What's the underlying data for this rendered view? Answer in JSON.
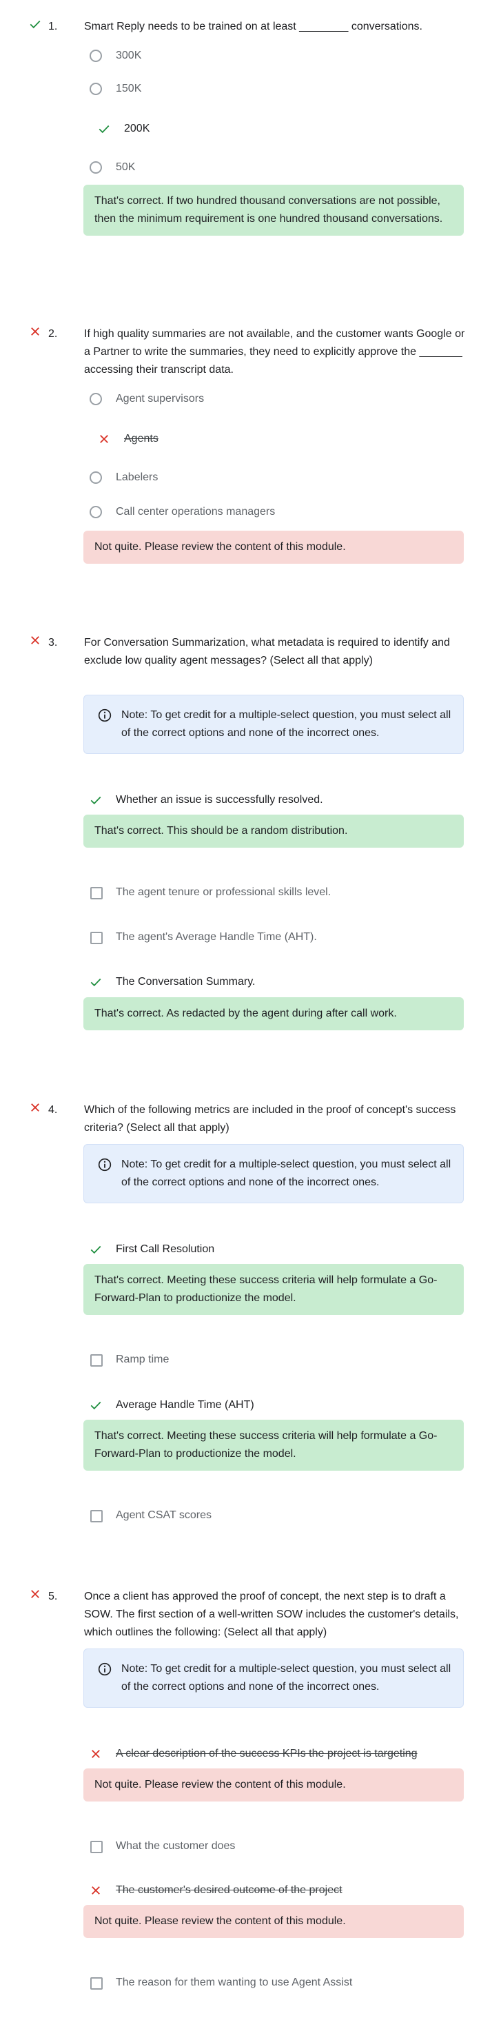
{
  "note_text": "Note: To get credit for a multiple-select question, you must select all of the correct options and none of the incorrect ones.",
  "colors": {
    "correct": "#1e8e3e",
    "incorrect": "#d93025",
    "success_bg": "#c8ecd0",
    "error_bg": "#f8d8d6",
    "note_bg": "#e6effc"
  },
  "questions": [
    {
      "number": "1.",
      "status": "correct",
      "text": "Smart Reply needs to be trained on at least ________ conversations.",
      "options": [
        {
          "label": "300K",
          "state": "unselected"
        },
        {
          "label": "150K",
          "state": "unselected"
        },
        {
          "label": "200K",
          "state": "correct"
        },
        {
          "label": "50K",
          "state": "unselected"
        }
      ],
      "feedback": "That's correct. If two hundred thousand conversations are not possible, then the minimum requirement is one hundred thousand conversations."
    },
    {
      "number": "2.",
      "status": "incorrect",
      "text": "If high quality summaries are not available, and the customer wants Google or a Partner to write the summaries, they need to explicitly approve the _______ accessing their transcript data.",
      "options": [
        {
          "label": "Agent supervisors",
          "state": "unselected"
        },
        {
          "label": "Agents",
          "state": "incorrect"
        },
        {
          "label": "Labelers",
          "state": "unselected"
        },
        {
          "label": "Call center operations managers",
          "state": "unselected"
        }
      ],
      "feedback": "Not quite. Please review the content of this module."
    },
    {
      "number": "3.",
      "status": "incorrect",
      "text": "For Conversation Summarization, what metadata is required to identify and exclude low quality agent messages? (Select all that apply)",
      "options": [
        {
          "label": "Whether an issue is successfully resolved.",
          "state": "correct",
          "feedback": "That's correct. This should be a random distribution."
        },
        {
          "label": "The agent tenure or professional skills level.",
          "state": "unselected"
        },
        {
          "label": "The agent's Average Handle Time (AHT).",
          "state": "unselected"
        },
        {
          "label": "The Conversation Summary.",
          "state": "correct",
          "feedback": "That's correct. As redacted by the agent during after call work."
        }
      ]
    },
    {
      "number": "4.",
      "status": "incorrect",
      "text": "Which of the following metrics are included in the proof of concept's success criteria? (Select all that apply)",
      "options": [
        {
          "label": "First Call Resolution",
          "state": "correct",
          "feedback": "That's correct. Meeting these success criteria will help formulate a Go-Forward-Plan to productionize the model."
        },
        {
          "label": "Ramp time",
          "state": "unselected"
        },
        {
          "label": "Average Handle Time (AHT)",
          "state": "correct",
          "feedback": "That's correct. Meeting these success criteria will help formulate a Go-Forward-Plan to productionize the model."
        },
        {
          "label": "Agent CSAT scores",
          "state": "unselected"
        }
      ]
    },
    {
      "number": "5.",
      "status": "incorrect",
      "text": "Once a client has approved the proof of concept, the next step is to draft a SOW. The first section of a well-written SOW includes the customer's details, which outlines the following: (Select all that apply)",
      "options": [
        {
          "label": "A clear description of the success KPIs the project is targeting",
          "state": "incorrect",
          "feedback": "Not quite. Please review the content of this module."
        },
        {
          "label": "What the customer does",
          "state": "unselected"
        },
        {
          "label": "The customer's desired outcome of the project",
          "state": "incorrect",
          "feedback": "Not quite. Please review the content of this module."
        },
        {
          "label": "The reason for them wanting to use Agent Assist",
          "state": "unselected"
        }
      ]
    }
  ]
}
